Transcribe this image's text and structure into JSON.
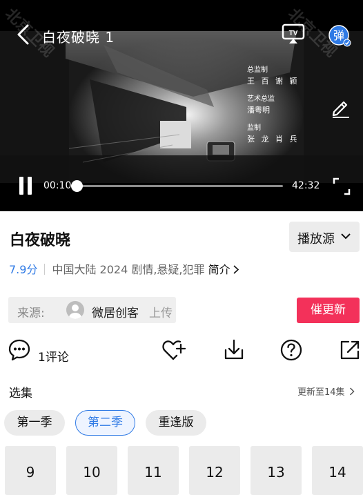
{
  "player": {
    "title": "白夜破晓 1",
    "current_time": "00:10",
    "total_time": "42:32",
    "progress_fraction": 0.004,
    "watermark": "北京卫视",
    "credits": {
      "group1_title": "总监制",
      "group1_names": "王 百 谢 颖",
      "group2_title": "艺术总监",
      "group2_name": "潘粤明",
      "group3_title": "监制",
      "group3_names": "张 龙 肖 兵"
    },
    "icons": [
      "back-icon",
      "tv-cast-icon",
      "danmu-icon",
      "edit-icon",
      "pause-icon",
      "fullscreen-icon"
    ]
  },
  "show": {
    "title": "白夜破晓",
    "source_label": "播放源",
    "score": "7.9分",
    "meta_text": "中国大陆  2024  剧情,悬疑,犯罪",
    "intro_label": "简介"
  },
  "uploader": {
    "from_label": "来源:",
    "name": "微居创客",
    "upload_label": "上传"
  },
  "urge_button": "催更新",
  "actions": {
    "comment_count": "1评论",
    "icons": [
      "comment-icon",
      "favorite-icon",
      "download-icon",
      "help-icon",
      "share-icon"
    ]
  },
  "episodes": {
    "title": "选集",
    "update_info": "更新至14集",
    "seasons": [
      {
        "label": "第一季",
        "active": false
      },
      {
        "label": "第二季",
        "active": true
      },
      {
        "label": "重逢版",
        "active": false
      }
    ],
    "items": [
      "9",
      "10",
      "11",
      "12",
      "13",
      "14"
    ]
  },
  "colors": {
    "accent_blue": "#2f7ae5",
    "urge_red": "#f3315a",
    "chip_gray": "#ebebeb"
  }
}
